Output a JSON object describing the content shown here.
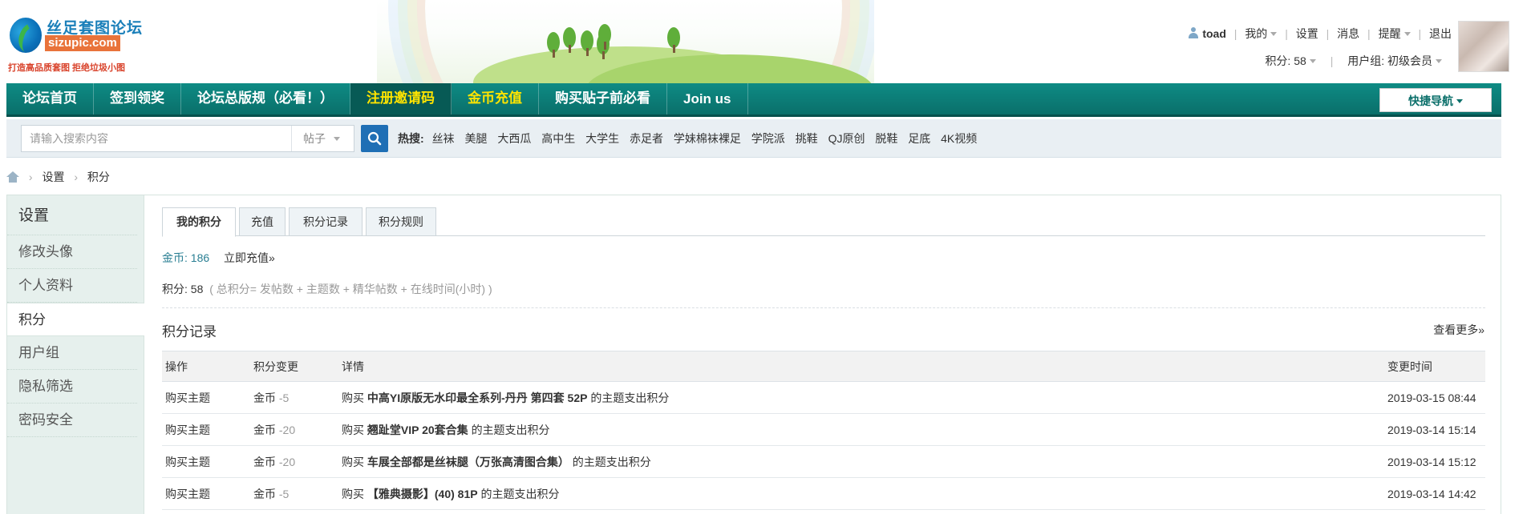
{
  "site": {
    "logo_cn": "丝足套图论坛",
    "logo_en": "sizupic.com",
    "slogan": "打造高品质套图 拒绝垃圾小图"
  },
  "user": {
    "name": "toad",
    "links": [
      "我的",
      "设置",
      "消息",
      "提醒",
      "退出"
    ],
    "points_label": "积分: 58",
    "group_label": "用户组: 初级会员"
  },
  "nav": {
    "items": [
      "论坛首页",
      "签到领奖",
      "论坛总版规（必看！）",
      "注册邀请码",
      "金币充值",
      "购买贴子前必看",
      "Join us"
    ],
    "quick_nav": "快捷导航"
  },
  "search": {
    "placeholder": "请输入搜索内容",
    "type": "帖子",
    "hot_label": "热搜:",
    "hot": [
      "丝袜",
      "美腿",
      "大西瓜",
      "高中生",
      "大学生",
      "赤足者",
      "学妹棉袜裸足",
      "学院派",
      "挑鞋",
      "QJ原创",
      "脱鞋",
      "足底",
      "4K视频"
    ]
  },
  "breadcrumb": [
    "设置",
    "积分"
  ],
  "sidebar": {
    "title": "设置",
    "items": [
      "修改头像",
      "个人资料",
      "积分",
      "用户组",
      "隐私筛选",
      "密码安全"
    ]
  },
  "tabs": [
    "我的积分",
    "充值",
    "积分记录",
    "积分规则"
  ],
  "credits": {
    "gold_label": "金币:",
    "gold_value": "186",
    "recharge_link": "立即充值»",
    "points_label": "积分:",
    "points_value": "58",
    "points_formula": "( 总积分= 发帖数 + 主题数 + 精华帖数 + 在线时间(小时) )"
  },
  "log": {
    "title": "积分记录",
    "see_more": "查看更多»",
    "headers": [
      "操作",
      "积分变更",
      "详情",
      "变更时间"
    ],
    "rows": [
      {
        "op": "购买主题",
        "currency": "金币",
        "delta": "-5",
        "buy": "购买",
        "title": "中高YI原版无水印最全系列-丹丹 第四套 52P",
        "suffix": "的主题支出积分",
        "time": "2019-03-15 08:44"
      },
      {
        "op": "购买主题",
        "currency": "金币",
        "delta": "-20",
        "buy": "购买",
        "title": "翘趾堂VIP 20套合集",
        "suffix": "的主题支出积分",
        "time": "2019-03-14 15:14"
      },
      {
        "op": "购买主题",
        "currency": "金币",
        "delta": "-20",
        "buy": "购买",
        "title": "车展全部都是丝袜腿（万张高清图合集）",
        "suffix": "的主题支出积分",
        "time": "2019-03-14 15:12"
      },
      {
        "op": "购买主题",
        "currency": "金币",
        "delta": "-5",
        "buy": "购买",
        "title": "【雅典摄影】(40) 81P",
        "suffix": "的主题支出积分",
        "time": "2019-03-14 14:42"
      }
    ]
  }
}
